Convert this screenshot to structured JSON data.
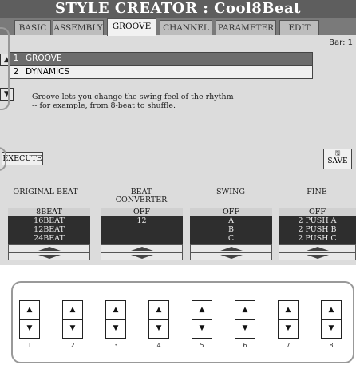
{
  "title": "STYLE CREATOR : Cool8Beat",
  "tabs": [
    "BASIC",
    "ASSEMBLY",
    "GROOVE",
    "CHANNEL",
    "PARAMETER",
    "EDIT"
  ],
  "active_tab": "GROOVE",
  "bar_label": "Bar:",
  "bar_value": "1",
  "side_up_icon": "up-arrow",
  "side_down_icon": "down-arrow",
  "list": [
    {
      "num": "1",
      "label": "GROOVE",
      "selected": true
    },
    {
      "num": "2",
      "label": "DYNAMICS",
      "selected": false
    }
  ],
  "description": [
    "Groove lets you change the swing feel of the rhythm",
    "-- for example, from 8-beat to shuffle."
  ],
  "execute_label": "EXECUTE",
  "save_label": "SAVE",
  "columns": [
    {
      "header": [
        "",
        "ORIGINAL BEAT"
      ],
      "items": [
        "8BEAT",
        "16BEAT",
        "12BEAT",
        "24BEAT"
      ],
      "selected": 0
    },
    {
      "header": [
        "BEAT",
        "CONVERTER"
      ],
      "items": [
        "OFF",
        "12"
      ],
      "selected": 0
    },
    {
      "header": [
        "",
        "SWING"
      ],
      "items": [
        "OFF",
        "A",
        "B",
        "C"
      ],
      "selected": 0
    },
    {
      "header": [
        "",
        "FINE"
      ],
      "items": [
        "OFF",
        "2 PUSH A",
        "2 PUSH B",
        "2 PUSH C"
      ],
      "selected": 0
    }
  ],
  "panel_buttons": [
    "1",
    "2",
    "3",
    "4",
    "5",
    "6",
    "7",
    "8"
  ],
  "colors": {
    "title_bg": "#5e5e5e",
    "lcd_bg": "#dcdcdc",
    "column_bg": "#2e2e2e",
    "selected_row": "#6c6c6c"
  }
}
